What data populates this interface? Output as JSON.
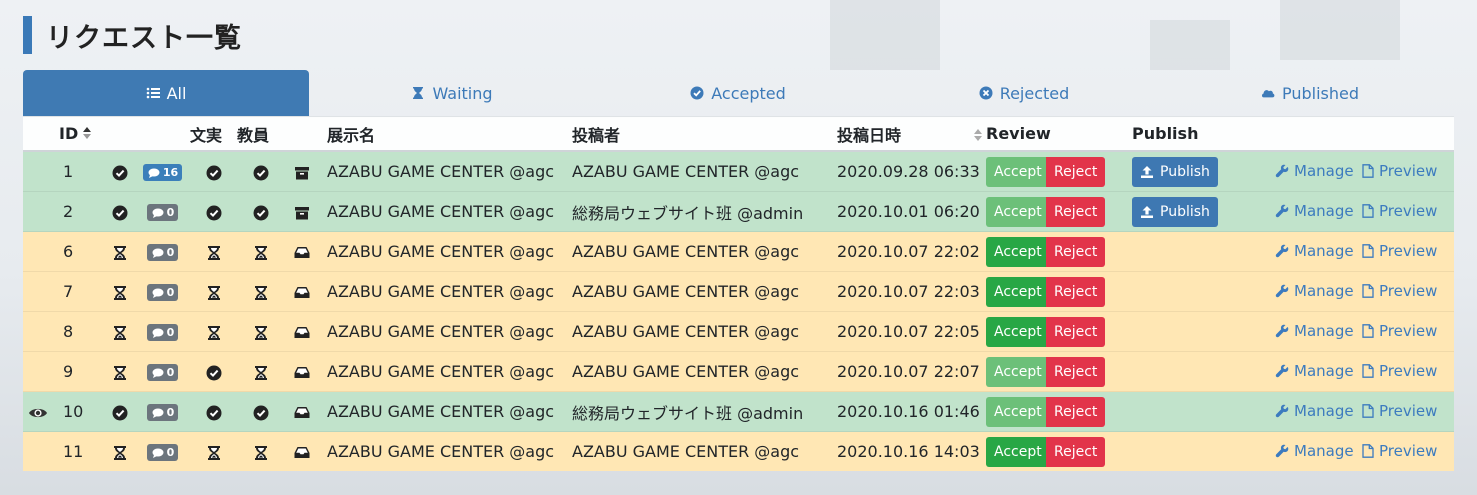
{
  "page": {
    "title": "リクエスト一覧"
  },
  "tabs": [
    {
      "label": "All",
      "icon": "list-icon",
      "active": true
    },
    {
      "label": "Waiting",
      "icon": "hourglass-icon",
      "active": false
    },
    {
      "label": "Accepted",
      "icon": "check-circle-icon",
      "active": false
    },
    {
      "label": "Rejected",
      "icon": "times-circle-icon",
      "active": false
    },
    {
      "label": "Published",
      "icon": "cloud-icon",
      "active": false
    }
  ],
  "table": {
    "headers": {
      "id": "ID",
      "bunjitsu": "文実",
      "kyoin": "教員",
      "exhibit": "展示名",
      "poster": "投稿者",
      "posted_at": "投稿日時",
      "review": "Review",
      "publish": "Publish"
    },
    "labels": {
      "accept": "Accept",
      "reject": "Reject",
      "publish": "Publish",
      "manage": "Manage",
      "preview": "Preview"
    },
    "rows": [
      {
        "id": "1",
        "watched": false,
        "status": "accepted",
        "comments": "16",
        "comment_highlight": true,
        "bunjitsu": "check",
        "kyoin": "check",
        "box": "archive",
        "exhibit": "AZABU GAME CENTER @agc",
        "poster": "AZABU GAME CENTER @agc",
        "posted_at": "2020.09.28 06:33",
        "accept_disabled": true,
        "show_publish": true
      },
      {
        "id": "2",
        "watched": false,
        "status": "accepted",
        "comments": "0",
        "comment_highlight": false,
        "bunjitsu": "check",
        "kyoin": "check",
        "box": "archive",
        "exhibit": "AZABU GAME CENTER @agc",
        "poster": "総務局ウェブサイト班 @admin",
        "posted_at": "2020.10.01 06:20",
        "accept_disabled": true,
        "show_publish": true
      },
      {
        "id": "6",
        "watched": false,
        "status": "waiting",
        "comments": "0",
        "comment_highlight": false,
        "bunjitsu": "hourglass",
        "kyoin": "hourglass",
        "box": "inbox",
        "exhibit": "AZABU GAME CENTER @agc",
        "poster": "AZABU GAME CENTER @agc",
        "posted_at": "2020.10.07 22:02",
        "accept_disabled": false,
        "show_publish": false
      },
      {
        "id": "7",
        "watched": false,
        "status": "waiting",
        "comments": "0",
        "comment_highlight": false,
        "bunjitsu": "hourglass",
        "kyoin": "hourglass",
        "box": "inbox",
        "exhibit": "AZABU GAME CENTER @agc",
        "poster": "AZABU GAME CENTER @agc",
        "posted_at": "2020.10.07 22:03",
        "accept_disabled": false,
        "show_publish": false
      },
      {
        "id": "8",
        "watched": false,
        "status": "waiting",
        "comments": "0",
        "comment_highlight": false,
        "bunjitsu": "hourglass",
        "kyoin": "hourglass",
        "box": "inbox",
        "exhibit": "AZABU GAME CENTER @agc",
        "poster": "AZABU GAME CENTER @agc",
        "posted_at": "2020.10.07 22:05",
        "accept_disabled": false,
        "show_publish": false
      },
      {
        "id": "9",
        "watched": false,
        "status": "waiting",
        "comments": "0",
        "comment_highlight": false,
        "bunjitsu": "check",
        "kyoin": "hourglass",
        "box": "inbox",
        "exhibit": "AZABU GAME CENTER @agc",
        "poster": "AZABU GAME CENTER @agc",
        "posted_at": "2020.10.07 22:07",
        "accept_disabled": true,
        "show_publish": false
      },
      {
        "id": "10",
        "watched": true,
        "status": "accepted",
        "comments": "0",
        "comment_highlight": false,
        "bunjitsu": "check",
        "kyoin": "check",
        "box": "inbox",
        "exhibit": "AZABU GAME CENTER @agc",
        "poster": "総務局ウェブサイト班 @admin",
        "posted_at": "2020.10.16 01:46",
        "accept_disabled": true,
        "show_publish": false
      },
      {
        "id": "11",
        "watched": false,
        "status": "waiting",
        "comments": "0",
        "comment_highlight": false,
        "bunjitsu": "hourglass",
        "kyoin": "hourglass",
        "box": "inbox",
        "exhibit": "AZABU GAME CENTER @agc",
        "poster": "AZABU GAME CENTER @agc",
        "posted_at": "2020.10.16 14:03",
        "accept_disabled": false,
        "show_publish": false
      }
    ]
  },
  "colors": {
    "accent": "#3f7ab3",
    "accepted_row": "#c1e3cb",
    "waiting_row": "#ffe7b4",
    "accept": "#28a745",
    "reject": "#e2344a"
  }
}
